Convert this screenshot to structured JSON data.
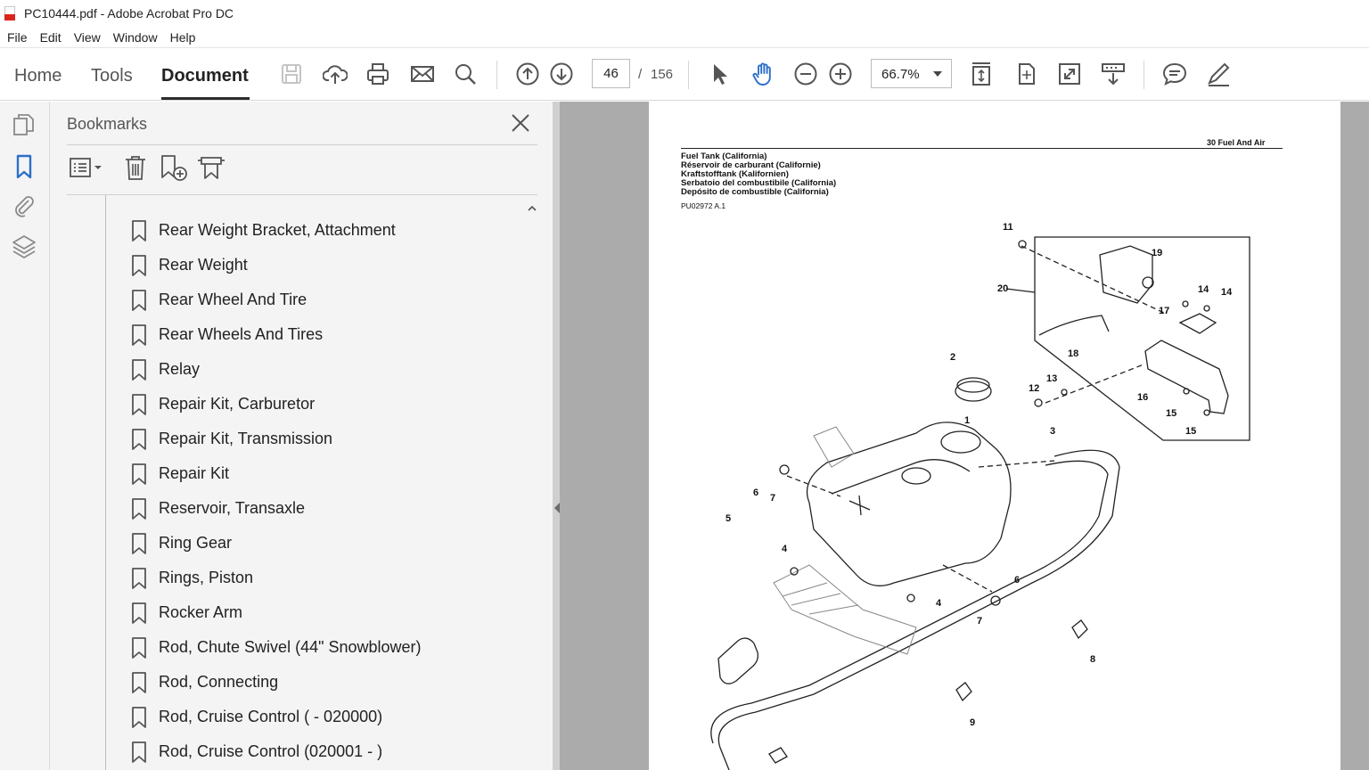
{
  "window": {
    "title": "PC10444.pdf - Adobe Acrobat Pro DC"
  },
  "menu": [
    "File",
    "Edit",
    "View",
    "Window",
    "Help"
  ],
  "toolbar": {
    "tabs": {
      "home": "Home",
      "tools": "Tools",
      "document": "Document"
    },
    "page_current": "46",
    "page_separator": "/",
    "page_total": "156",
    "zoom": "66.7%"
  },
  "bookmarks": {
    "title": "Bookmarks",
    "items": [
      "Rear Weight Bracket, Attachment",
      "Rear Weight",
      "Rear Wheel And Tire",
      "Rear Wheels And Tires",
      "Relay",
      "Repair Kit, Carburetor",
      "Repair Kit, Transmission",
      "Repair Kit",
      "Reservoir, Transaxle",
      "Ring Gear",
      "Rings, Piston",
      "Rocker Arm",
      "Rod, Chute Swivel (44\" Snowblower)",
      "Rod, Connecting",
      "Rod, Cruise Control ( - 020000)",
      "Rod, Cruise Control (020001 - )"
    ]
  },
  "document": {
    "section": "30  Fuel  And  Air",
    "title_lines": [
      "Fuel Tank (California)",
      "Réservoir de carburant (Californie)",
      "Kraftstofftank (Kalifornien)",
      "Serbatoio del combustibile (California)",
      "Depósito de combustible (California)"
    ],
    "part_ref": "PU02972 A.1",
    "callouts": [
      "1",
      "2",
      "3",
      "4",
      "4",
      "5",
      "6",
      "6",
      "7",
      "7",
      "8",
      "9",
      "11",
      "12",
      "13",
      "14",
      "14",
      "15",
      "15",
      "16",
      "17",
      "18",
      "19",
      "20"
    ]
  },
  "colors": {
    "accent": "#2c6fc9",
    "doc_bg": "#ababab",
    "panel_bg": "#f4f4f4"
  }
}
